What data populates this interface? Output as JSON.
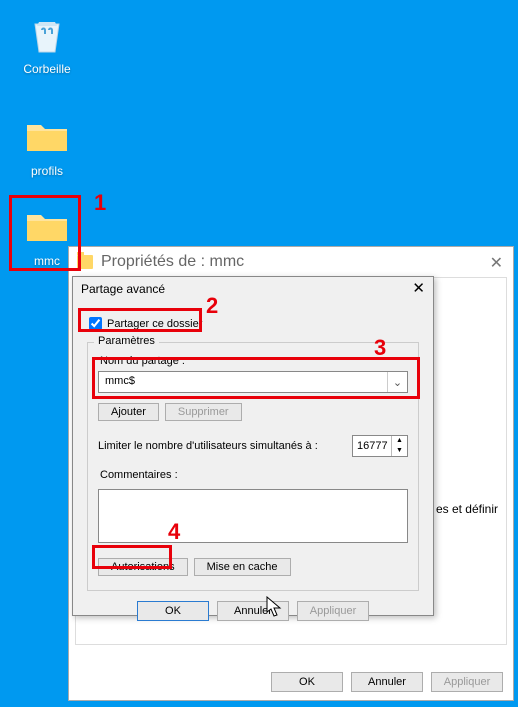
{
  "desktop": {
    "icons": [
      {
        "name": "recycle-bin",
        "label": "Corbeille"
      },
      {
        "name": "folder-profils",
        "label": "profils"
      },
      {
        "name": "folder-mmc",
        "label": "mmc"
      }
    ]
  },
  "properties_window": {
    "title": "Propriétés de : mmc",
    "peek_text": "es et définir",
    "buttons": {
      "ok": "OK",
      "cancel": "Annuler",
      "apply": "Appliquer"
    }
  },
  "advanced_sharing": {
    "title": "Partage avancé",
    "share_checkbox_label": "Partager ce dossier",
    "share_checked": true,
    "params_legend": "Paramètres",
    "share_name_label": "Nom du partage :",
    "share_name_value": "mmc$",
    "add_label": "Ajouter",
    "remove_label": "Supprimer",
    "limit_label": "Limiter le nombre d'utilisateurs simultanés à :",
    "limit_value": "16777",
    "comments_label": "Commentaires :",
    "comments_value": "",
    "permissions_label": "Autorisations",
    "cache_label": "Mise en cache",
    "buttons": {
      "ok": "OK",
      "cancel": "Annuler",
      "apply": "Appliquer"
    }
  },
  "annotations": {
    "n1": "1",
    "n2": "2",
    "n3": "3",
    "n4": "4"
  }
}
